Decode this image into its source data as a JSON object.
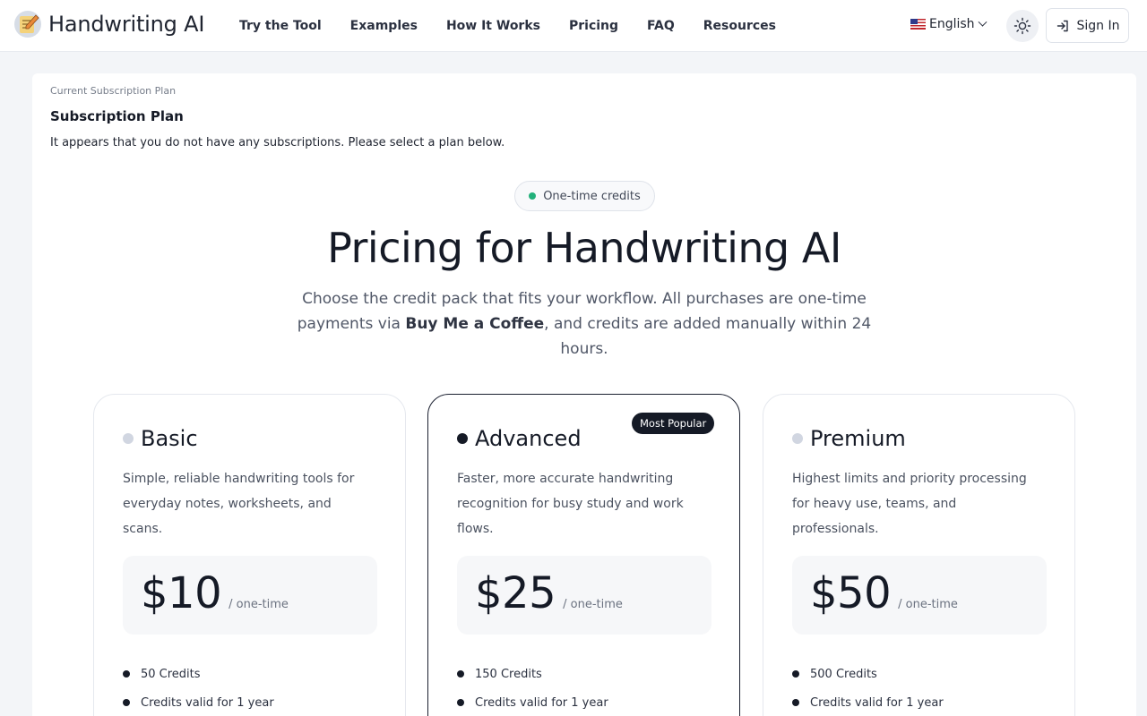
{
  "brand": {
    "name": "Handwriting AI"
  },
  "nav": {
    "items": [
      {
        "label": "Try the Tool"
      },
      {
        "label": "Examples"
      },
      {
        "label": "How It Works"
      },
      {
        "label": "Pricing"
      },
      {
        "label": "FAQ"
      },
      {
        "label": "Resources"
      }
    ]
  },
  "header": {
    "language": "English",
    "theme_icon": "sun-icon",
    "signin_label": "Sign In"
  },
  "subscription": {
    "breadcrumb": "Current Subscription Plan",
    "title": "Subscription Plan",
    "message": "It appears that you do not have any subscriptions. Please select a plan below."
  },
  "pricing": {
    "badge": "One-time credits",
    "badge_color": "#22b07a",
    "title": "Pricing for Handwriting AI",
    "desc_part1": "Choose the credit pack that fits your workflow. All purchases are one-time payments via ",
    "desc_bold": "Buy Me a Coffee",
    "desc_part2": ", and credits are added manually within 24 hours."
  },
  "plans": [
    {
      "name": "Basic",
      "description": "Simple, reliable handwriting tools for everyday notes, worksheets, and scans.",
      "price": "$10",
      "period": "/ one-time",
      "features": [
        "50 Credits",
        "Credits valid for 1 year"
      ]
    },
    {
      "name": "Advanced",
      "badge": "Most Popular",
      "description": "Faster, more accurate handwriting recognition for busy study and work flows.",
      "price": "$25",
      "period": "/ one-time",
      "features": [
        "150 Credits",
        "Credits valid for 1 year"
      ]
    },
    {
      "name": "Premium",
      "description": "Highest limits and priority processing for heavy use, teams, and professionals.",
      "price": "$50",
      "period": "/ one-time",
      "features": [
        "500 Credits",
        "Credits valid for 1 year"
      ]
    }
  ]
}
